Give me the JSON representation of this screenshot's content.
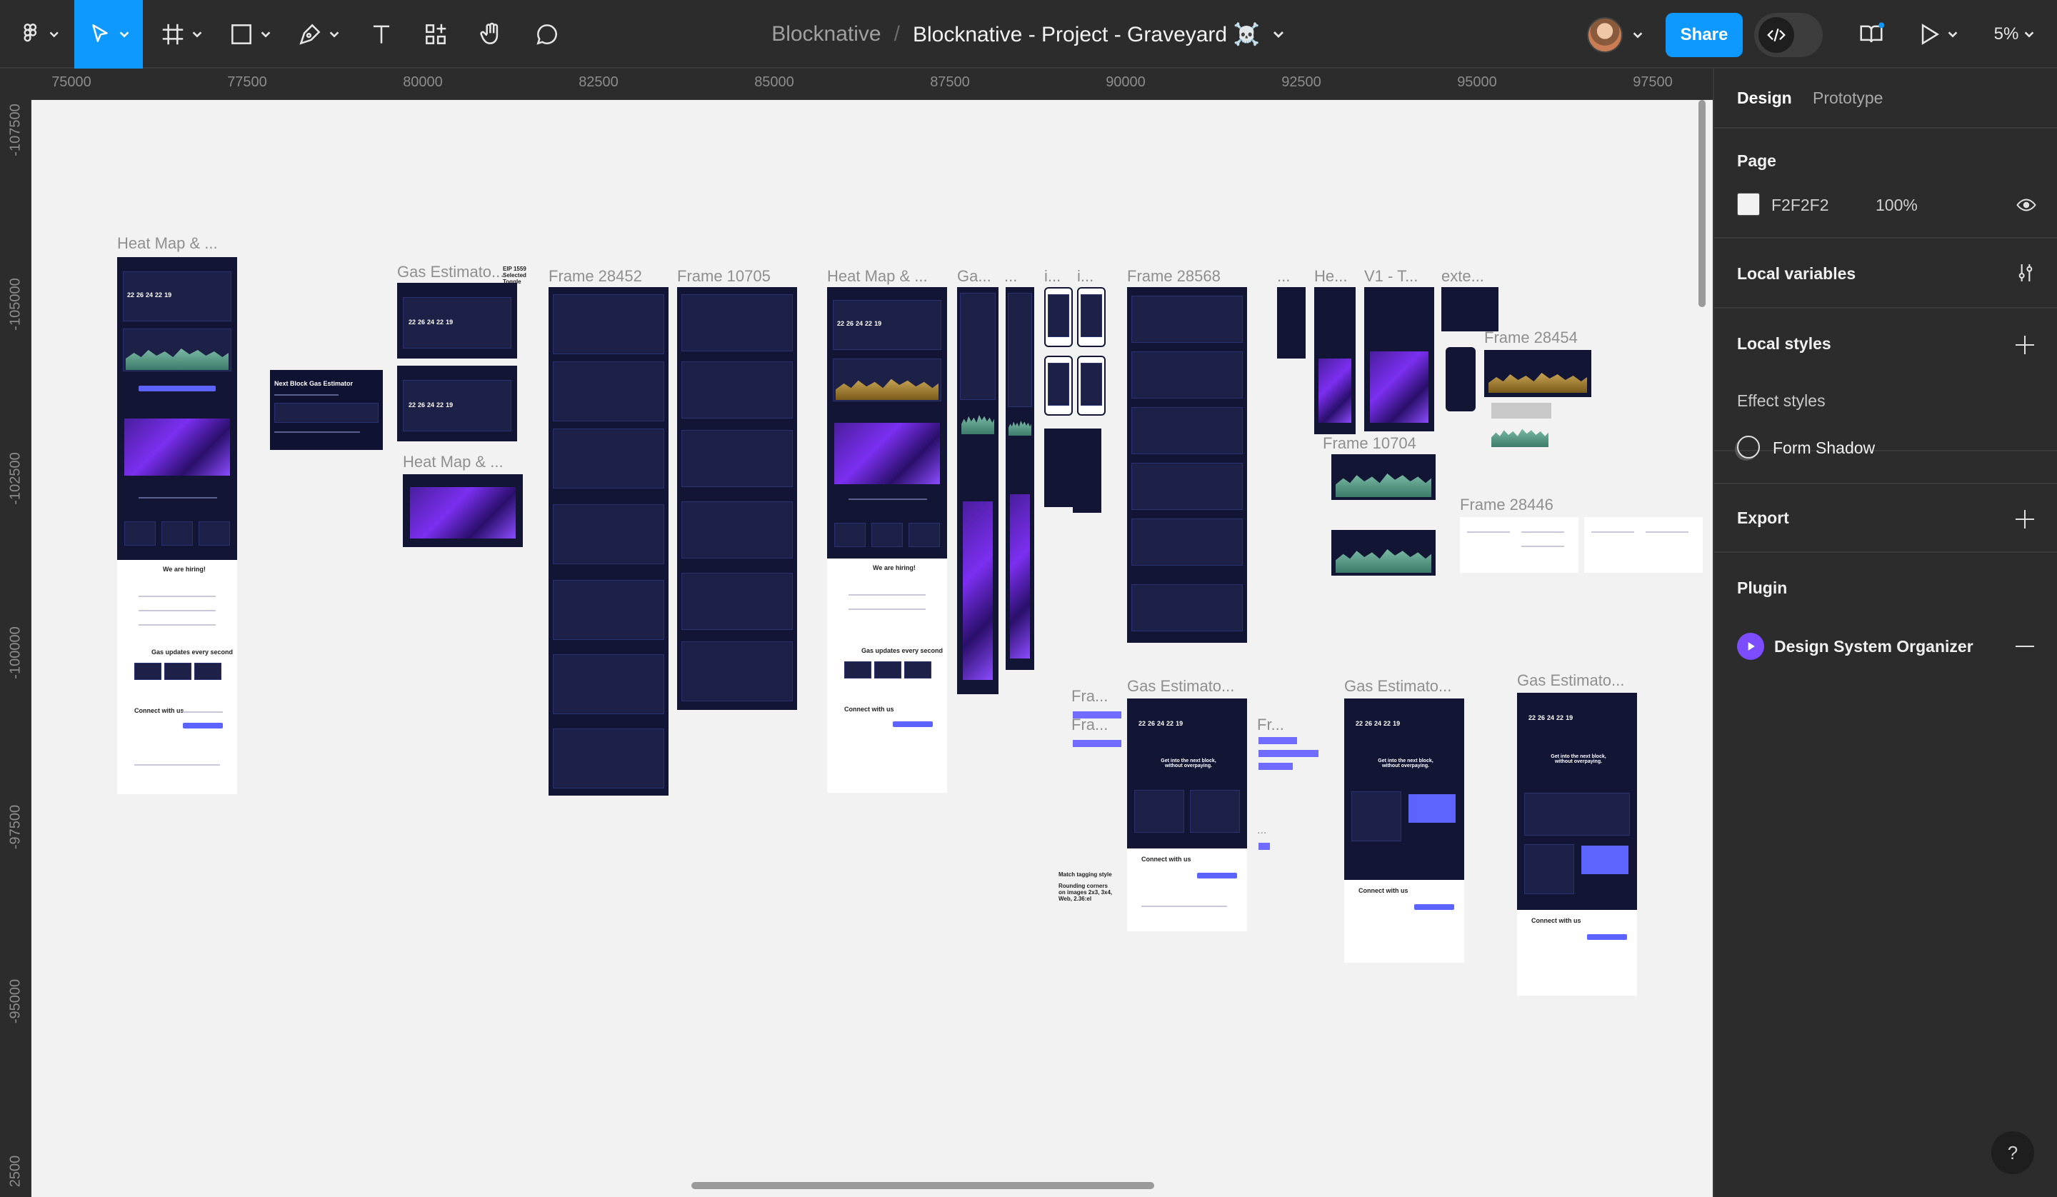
{
  "toolbar": {
    "team": "Blocknative",
    "separator": "/",
    "file_name": "Blocknative - Project - Graveyard ☠️",
    "share_label": "Share",
    "zoom": "5%",
    "accent": "#0d99ff"
  },
  "ruler": {
    "top": [
      "75000",
      "77500",
      "80000",
      "82500",
      "85000",
      "87500",
      "90000",
      "92500",
      "95000",
      "97500"
    ],
    "left": [
      "-107500",
      "-105000",
      "-102500",
      "-100000",
      "-97500",
      "-95000",
      "2500"
    ]
  },
  "canvas": {
    "background": "#f2f2f2",
    "labels": {
      "heatmap1": "Heat Map & ...",
      "gas1": "Gas Estimato...",
      "eip": "EIP 1559 Selected Toggle",
      "frame28452": "Frame 28452",
      "frame10705": "Frame 10705",
      "heatmap2": "Heat Map & ...",
      "heatmap_small": "Heat Map & ...",
      "ga": "Ga...",
      "dots1": "...",
      "i1": "i...",
      "i2": "i...",
      "frame28568": "Frame 28568",
      "dots2": "...",
      "he": "He...",
      "v1": "V1 - T...",
      "exte": "exte...",
      "frame28454": "Frame 28454",
      "frame10704": "Frame 10704",
      "frame28446": "Frame 28446",
      "fra1": "Fra...",
      "fra2": "Fra...",
      "gas2": "Gas Estimato...",
      "fr": "Fr...",
      "gas3": "Gas Estimato...",
      "gas4": "Gas Estimato...",
      "dots3": "..."
    },
    "mock": {
      "hero_title": "Next Block Gas Estimator",
      "nums": [
        "22",
        "26",
        "24",
        "22",
        "19"
      ],
      "we_are_hiring": "We are hiring!",
      "gas_updates": "Gas updates every second",
      "connect": "Connect with us",
      "tagline": "Get into the next block, without overpaying.",
      "match_style": "Match tagging style",
      "rounding": "Rounding corners on images 2x3, 3x4, Web, 2.36:el"
    }
  },
  "panel": {
    "tabs": [
      "Design",
      "Prototype"
    ],
    "page_title": "Page",
    "page_color": "F2F2F2",
    "page_opacity": "100%",
    "local_variables": "Local variables",
    "local_styles": "Local styles",
    "effect_styles": "Effect styles",
    "form_shadow": "Form Shadow",
    "export": "Export",
    "plugin": "Plugin",
    "plugin_name": "Design System Organizer",
    "help": "?"
  }
}
